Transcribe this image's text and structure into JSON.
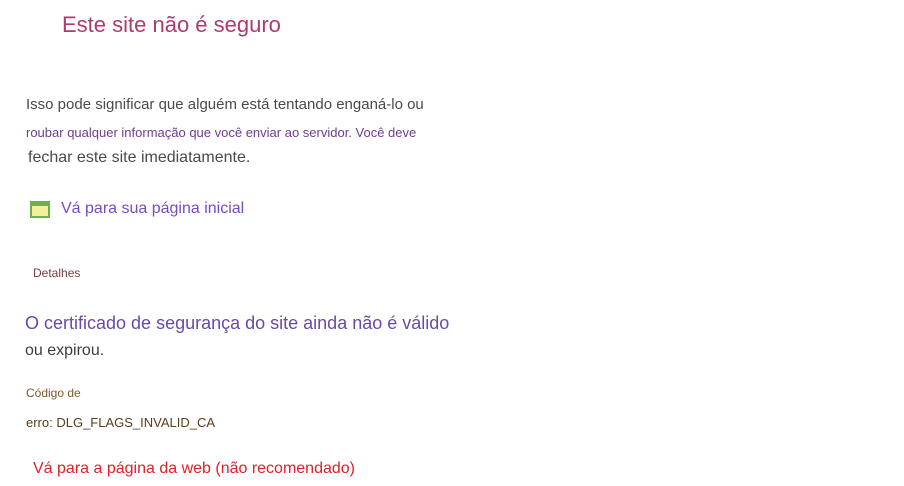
{
  "page": {
    "title": "Este site não é seguro",
    "warning_line1": "Isso pode significar que alguém está tentando enganá-lo ou",
    "warning_line2": "roubar qualquer informação que você enviar ao servidor. Você deve",
    "warning_line3": "fechar este site imediatamente."
  },
  "home_link": {
    "icon": "browser-window-icon",
    "label": "Vá para sua página inicial"
  },
  "details": {
    "label": "Detalhes",
    "cert_line1": "O certificado de segurança do site ainda não é válido",
    "cert_line2": "ou expirou.",
    "error_label": "Código de",
    "error_value": "erro: DLG_FLAGS_INVALID_CA"
  },
  "proceed_link": {
    "label": "Vá para a página da web (não recomendado)"
  },
  "colors": {
    "title": "#b03a6e",
    "link": "#7a4bbf",
    "danger_link": "#e0202a",
    "icon_green": "#6ab04c"
  }
}
